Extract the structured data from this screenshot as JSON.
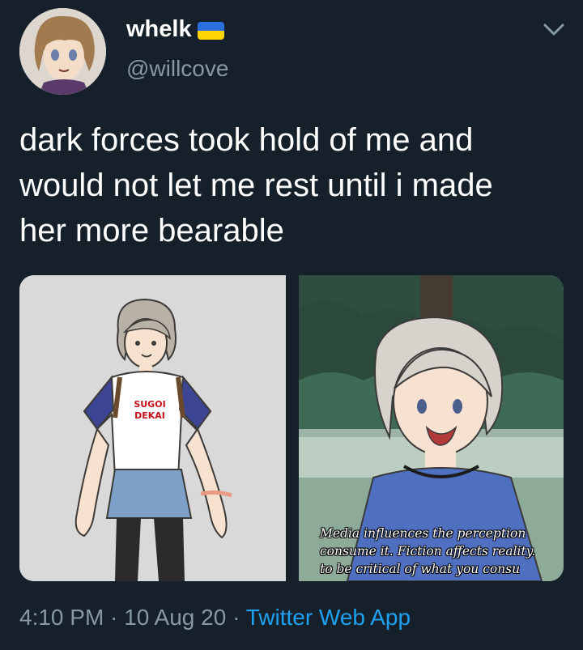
{
  "user": {
    "display_name": "whelk",
    "handle": "@willcove",
    "flag_icon": "ukraine-flag-icon",
    "flag_colors": [
      "#2a6fdb",
      "#ffd500"
    ]
  },
  "tweet": {
    "text": "dark forces took hold of me and\nwould not let me rest until i made\nher more bearable"
  },
  "media": {
    "left_image": {
      "shirt_text_top": "SUGOI",
      "shirt_text_bottom": "DEKAI"
    },
    "right_image": {
      "caption_lines": [
        "Media influences the perception",
        "consume it. Fiction affects reality.",
        "to be critical of what you consu"
      ]
    }
  },
  "meta": {
    "time": "4:10 PM",
    "sep1": " · ",
    "date": "10 Aug 20",
    "sep2": " · ",
    "source": "Twitter Web App"
  },
  "icons": {
    "more": "chevron-down-icon"
  },
  "colors": {
    "background": "#15202b",
    "secondary_text": "#8899a6",
    "link": "#1da1f2"
  }
}
